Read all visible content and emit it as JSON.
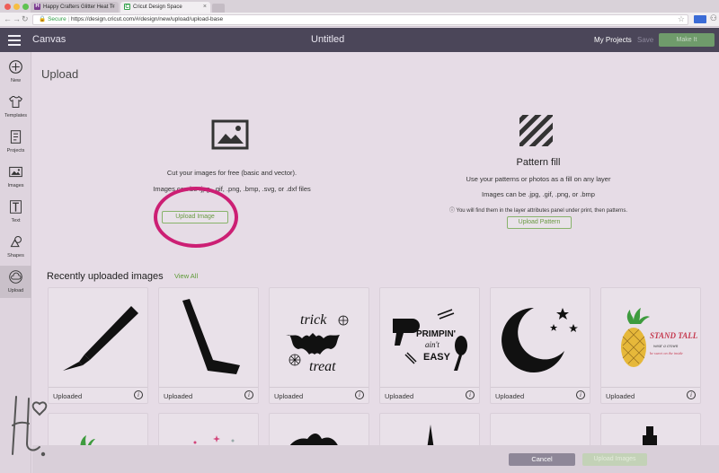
{
  "browser": {
    "tabs": [
      {
        "title": "Happy Crafters Glitter Heat Tr",
        "favicon": "H"
      },
      {
        "title": "Cricut Design Space",
        "favicon": "C"
      }
    ],
    "secure_label": "Secure",
    "url": "https://design.cricut.com/#/design/new/upload/upload-base"
  },
  "header": {
    "canvas_label": "Canvas",
    "doc_title": "Untitled",
    "my_projects": "My Projects",
    "save": "Save",
    "make_it": "Make It"
  },
  "sidebar": {
    "items": [
      {
        "label": "New",
        "icon": "plus-circle-icon"
      },
      {
        "label": "Templates",
        "icon": "shirt-icon"
      },
      {
        "label": "Projects",
        "icon": "projects-icon"
      },
      {
        "label": "Images",
        "icon": "image-icon"
      },
      {
        "label": "Text",
        "icon": "text-icon"
      },
      {
        "label": "Shapes",
        "icon": "shapes-icon"
      },
      {
        "label": "Upload",
        "icon": "cloud-upload-icon"
      }
    ]
  },
  "upload": {
    "title": "Upload",
    "left": {
      "line1": "Cut your images for free (basic and vector).",
      "line2": "Images can be .jpg, .gif, .png, .bmp, .svg, or .dxf files",
      "button": "Upload Image"
    },
    "right": {
      "title": "Pattern fill",
      "line1": "Use your patterns or photos as a fill on any layer",
      "line2": "Images can be .jpg, .gif, .png, or .bmp",
      "note": "You will find them in the layer attributes panel under print, then patterns.",
      "button": "Upload Pattern"
    }
  },
  "recent": {
    "heading": "Recently uploaded images",
    "view_all": "View All",
    "cards": [
      {
        "label": "Uploaded",
        "art": "craft-knife"
      },
      {
        "label": "Uploaded",
        "art": "hockey-stick"
      },
      {
        "label": "Uploaded",
        "art": "trick-treat-bat",
        "text1": "trick",
        "text2": "treat"
      },
      {
        "label": "Uploaded",
        "art": "primpin-aint-easy",
        "text1": "PRIMPIN'",
        "text2": "ain't",
        "text3": "EASY"
      },
      {
        "label": "Uploaded",
        "art": "moon-stars"
      },
      {
        "label": "Uploaded",
        "art": "pineapple-stand-tall",
        "text1": "STAND TALL",
        "text2": "wear a crown",
        "text3": "be sweet on the inside"
      }
    ]
  },
  "footer": {
    "cancel": "Cancel",
    "upload_images": "Upload Images"
  },
  "colors": {
    "accent_green": "#6b9a44",
    "highlight_circle": "#cc1f74",
    "header_bg": "#4b4659"
  }
}
